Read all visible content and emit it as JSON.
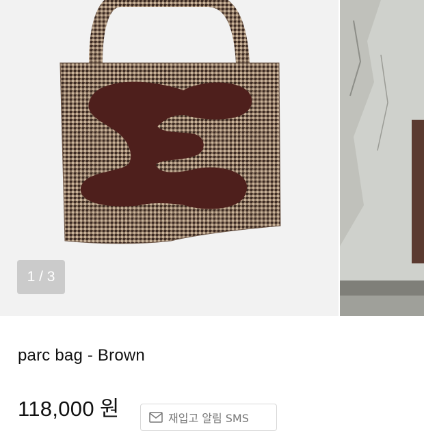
{
  "gallery": {
    "counter": "1 / 3",
    "main_image_alt": "brown houndstooth tote bag",
    "next_image_alt": "tote bag worn against concrete wall"
  },
  "product": {
    "title": "parc bag - Brown",
    "price": "118,000",
    "currency": "원"
  },
  "restock": {
    "label": "재입고 알림 SMS",
    "icon": "mail-icon"
  }
}
